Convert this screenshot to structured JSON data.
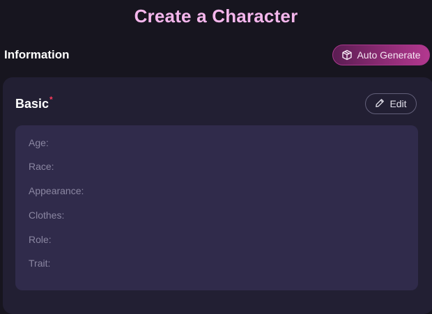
{
  "page": {
    "title": "Create a Character"
  },
  "information": {
    "label": "Information",
    "auto_generate_label": "Auto Generate"
  },
  "basic": {
    "title": "Basic",
    "required_mark": "*",
    "edit_label": "Edit",
    "fields": [
      {
        "label": "Age:"
      },
      {
        "label": "Race:"
      },
      {
        "label": "Appearance:"
      },
      {
        "label": "Clothes:"
      },
      {
        "label": "Role:"
      },
      {
        "label": "Trait:"
      }
    ]
  },
  "colors": {
    "background": "#17151f",
    "title": "#f4b6ec",
    "card": "#221f33",
    "field_box": "#302b4b",
    "accent_gradient_start": "#5a1d52",
    "accent_gradient_end": "#b3388f",
    "required": "#ff3b5c"
  },
  "icons": {
    "auto_generate": "cube-icon",
    "edit": "pencil-icon"
  }
}
